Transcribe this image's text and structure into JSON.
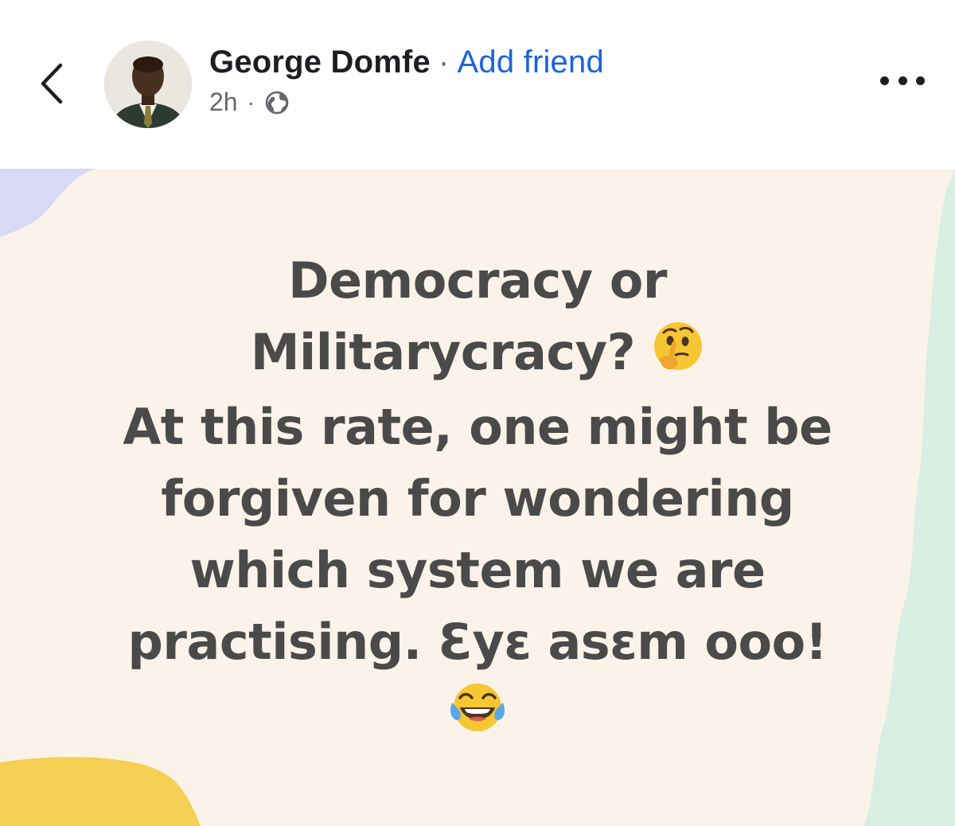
{
  "post": {
    "author_name": "George Domfe",
    "name_separator": "·",
    "add_friend_label": "Add friend",
    "time_ago": "2h",
    "meta_separator": "·",
    "audience_icon": "globe-icon",
    "avatar_icon": "profile-photo",
    "text_lines": [
      "Democracy or",
      "Militarycracy?",
      "At this rate, one might be",
      "forgiven for wondering",
      "which system we are",
      "practising. Ɛyɛ asɛm ooo!"
    ],
    "emojis": {
      "thinking": "thinking-face-emoji",
      "laughing": "face-with-tears-of-joy-emoji"
    },
    "background_colors": {
      "base": "#fbf3ea",
      "lavender": "#d9d8f5",
      "mint": "#d8efe3",
      "yellow": "#f6cf55"
    },
    "accent_color": "#1b64d8"
  }
}
